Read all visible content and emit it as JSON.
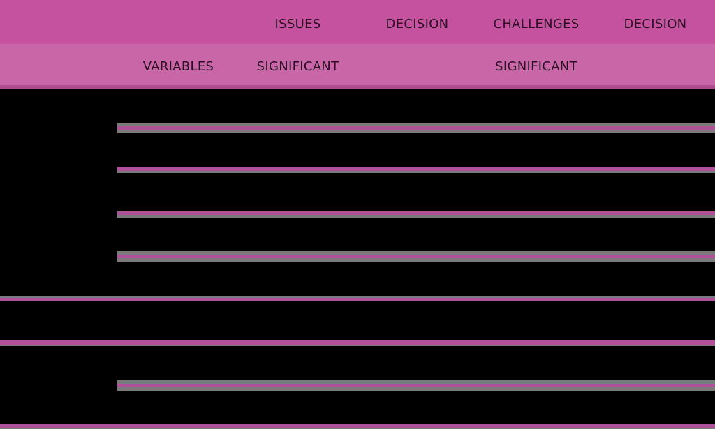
{
  "table": {
    "header_row_1": {
      "col3": "ISSUES",
      "col4": "DECISION",
      "col5": "CHALLENGES",
      "col6": "DECISION"
    },
    "header_row_2": {
      "col2": "VARIABLES",
      "col3": "SIGNIFICANT",
      "col5": "SIGNIFICANT"
    }
  },
  "colors": {
    "header_row_1_bg": "#c4529e",
    "header_row_2_bg": "#c866a8",
    "body_bg": "#000000",
    "rule_pink": "#b0509a",
    "rule_gray": "#7a7a7a"
  }
}
